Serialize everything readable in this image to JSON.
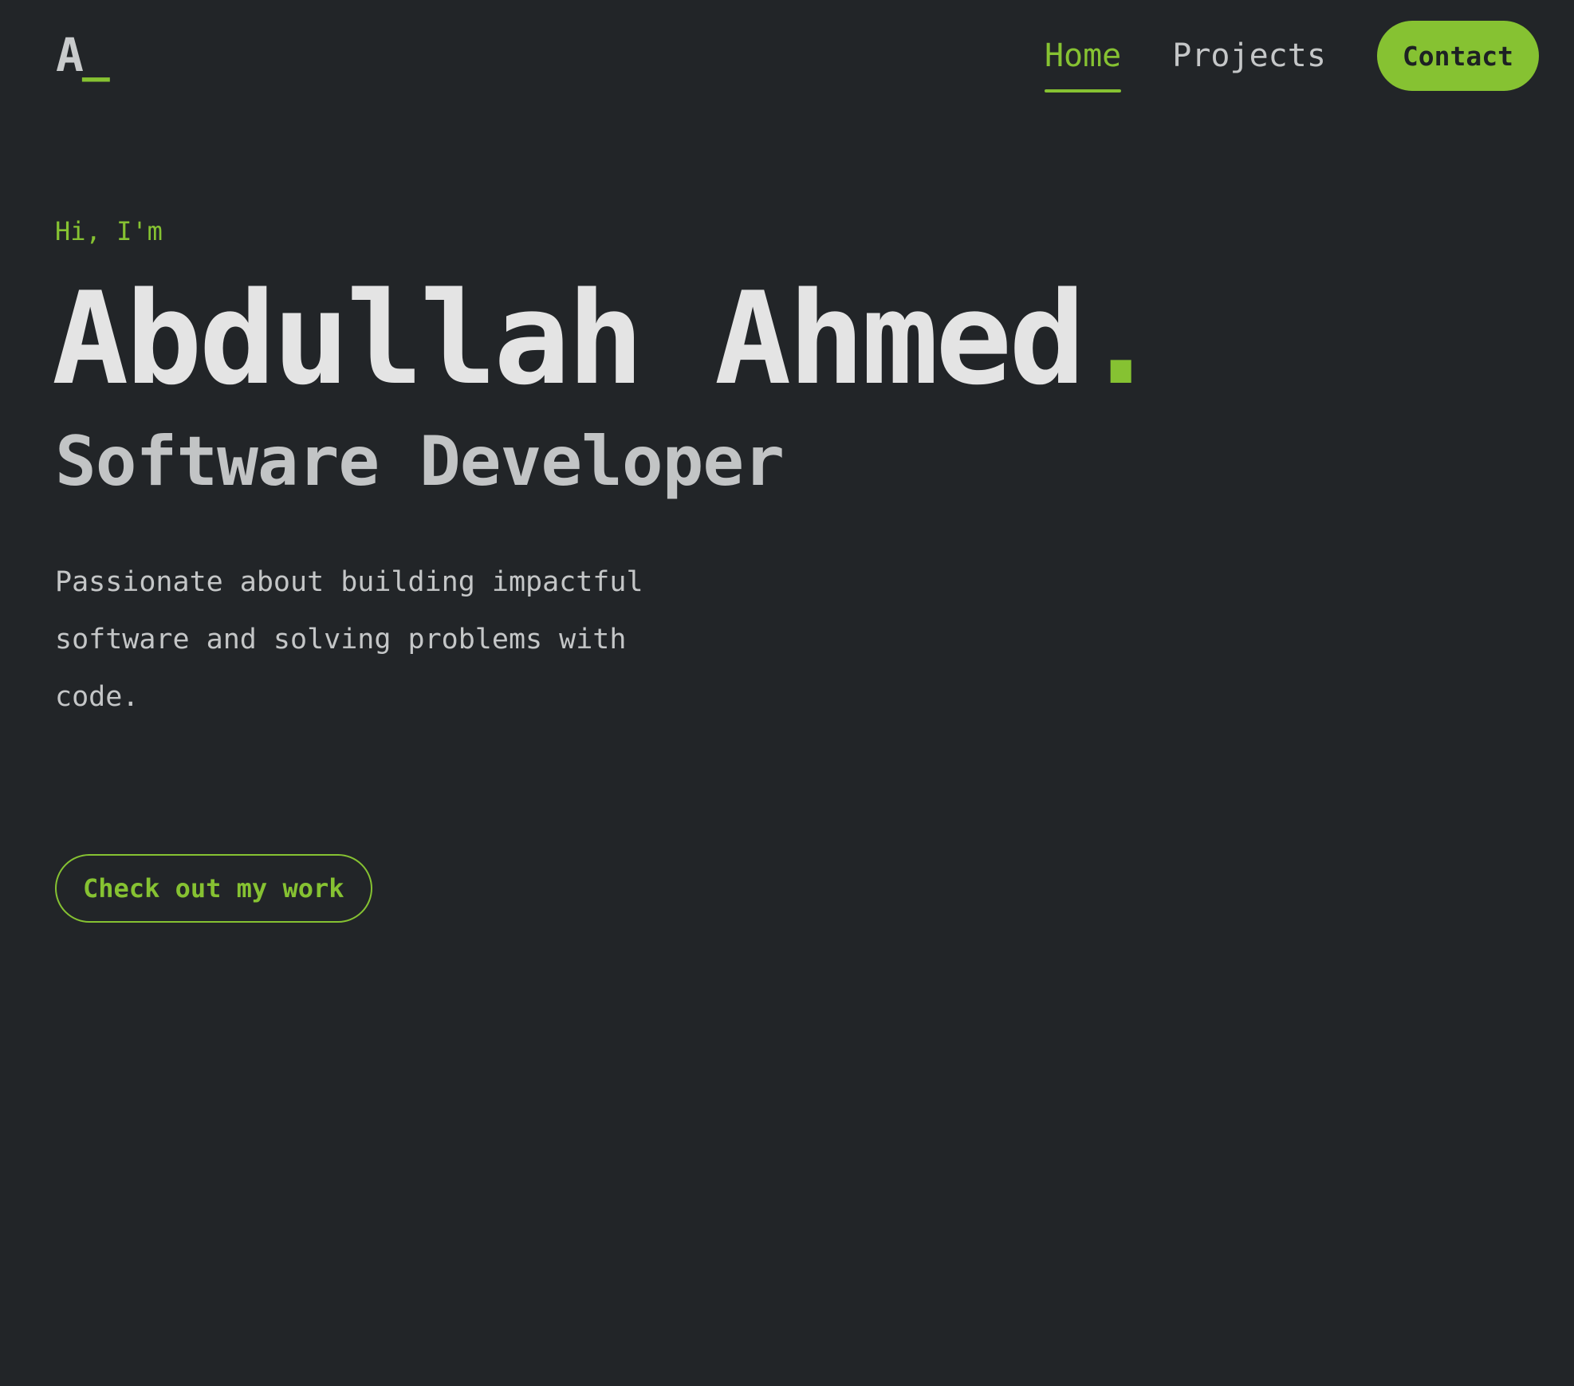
{
  "brand": {
    "logo_letter": "A",
    "logo_cursor": "_"
  },
  "nav": {
    "items": [
      {
        "label": "Home",
        "active": true
      },
      {
        "label": "Projects",
        "active": false
      }
    ],
    "contact_label": "Contact"
  },
  "hero": {
    "greeting": "Hi, I'm",
    "name": "Abdullah Ahmed",
    "name_dot": ".",
    "role": "Software Developer",
    "bio": "Passionate about building impactful software and solving problems with code.",
    "cta_label": "Check out my work"
  },
  "colors": {
    "background": "#222528",
    "accent": "#86c232",
    "text_primary": "#e4e4e4",
    "text_secondary": "#c4c6c7"
  }
}
